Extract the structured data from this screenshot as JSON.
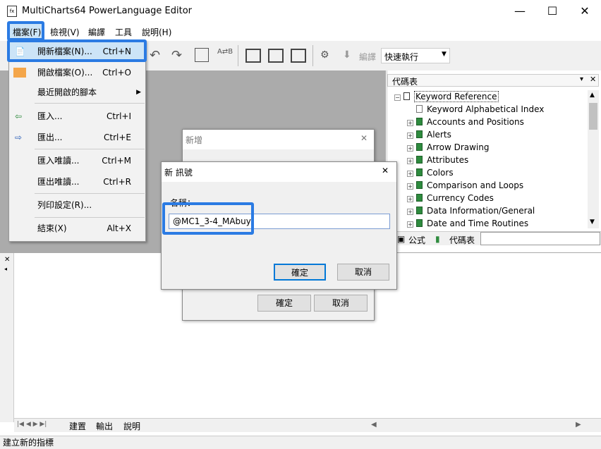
{
  "window": {
    "title": "MultiCharts64 PowerLanguage Editor",
    "icon": "fx-app-icon",
    "minimize": "—",
    "maximize": "☐",
    "close": "✕"
  },
  "menubar": {
    "items": [
      {
        "label": "檔案(F)"
      },
      {
        "label": "檢視(V)"
      },
      {
        "label": "編譯"
      },
      {
        "label": "工具"
      },
      {
        "label": "說明(H)"
      }
    ]
  },
  "toolbar": {
    "compile_label": "編譯",
    "quick_exec": "快速執行"
  },
  "file_menu": {
    "items": [
      {
        "label": "開新檔案(N)...",
        "shortcut": "Ctrl+N",
        "icon": "new-file-icon"
      },
      {
        "label": "開啟檔案(O)...",
        "shortcut": "Ctrl+O",
        "icon": "open-folder-icon"
      },
      {
        "label": "最近開啟的腳本",
        "shortcut": "",
        "icon": ""
      },
      {
        "label": "匯入...",
        "shortcut": "Ctrl+I",
        "icon": "import-icon"
      },
      {
        "label": "匯出...",
        "shortcut": "Ctrl+E",
        "icon": "export-icon"
      },
      {
        "label": "匯入唯讀...",
        "shortcut": "Ctrl+M",
        "icon": ""
      },
      {
        "label": "匯出唯讀...",
        "shortcut": "Ctrl+R",
        "icon": ""
      },
      {
        "label": "列印設定(R)...",
        "shortcut": "",
        "icon": ""
      },
      {
        "label": "結束(X)",
        "shortcut": "Alt+X",
        "icon": ""
      }
    ]
  },
  "right_panel": {
    "title": "代碼表",
    "tree": [
      "Keyword Reference",
      "Keyword Alphabetical Index",
      "Accounts and Positions",
      "Alerts",
      "Arrow Drawing",
      "Attributes",
      "Colors",
      "Comparison and Loops",
      "Currency Codes",
      "Data Information/General",
      "Date and Time Routines"
    ],
    "tabs": [
      "公式",
      "代碼表"
    ]
  },
  "dialog_new": {
    "title": "新增",
    "ok": "確定",
    "cancel": "取消"
  },
  "dialog_signal": {
    "title": "新 訊號",
    "name_label": "名稱：",
    "name_value": "@MC1_3-4_MAbuy",
    "ok": "確定",
    "cancel": "取消"
  },
  "bottom_tabs": [
    "建置",
    "輸出",
    "說明"
  ],
  "status": "建立新的指標"
}
